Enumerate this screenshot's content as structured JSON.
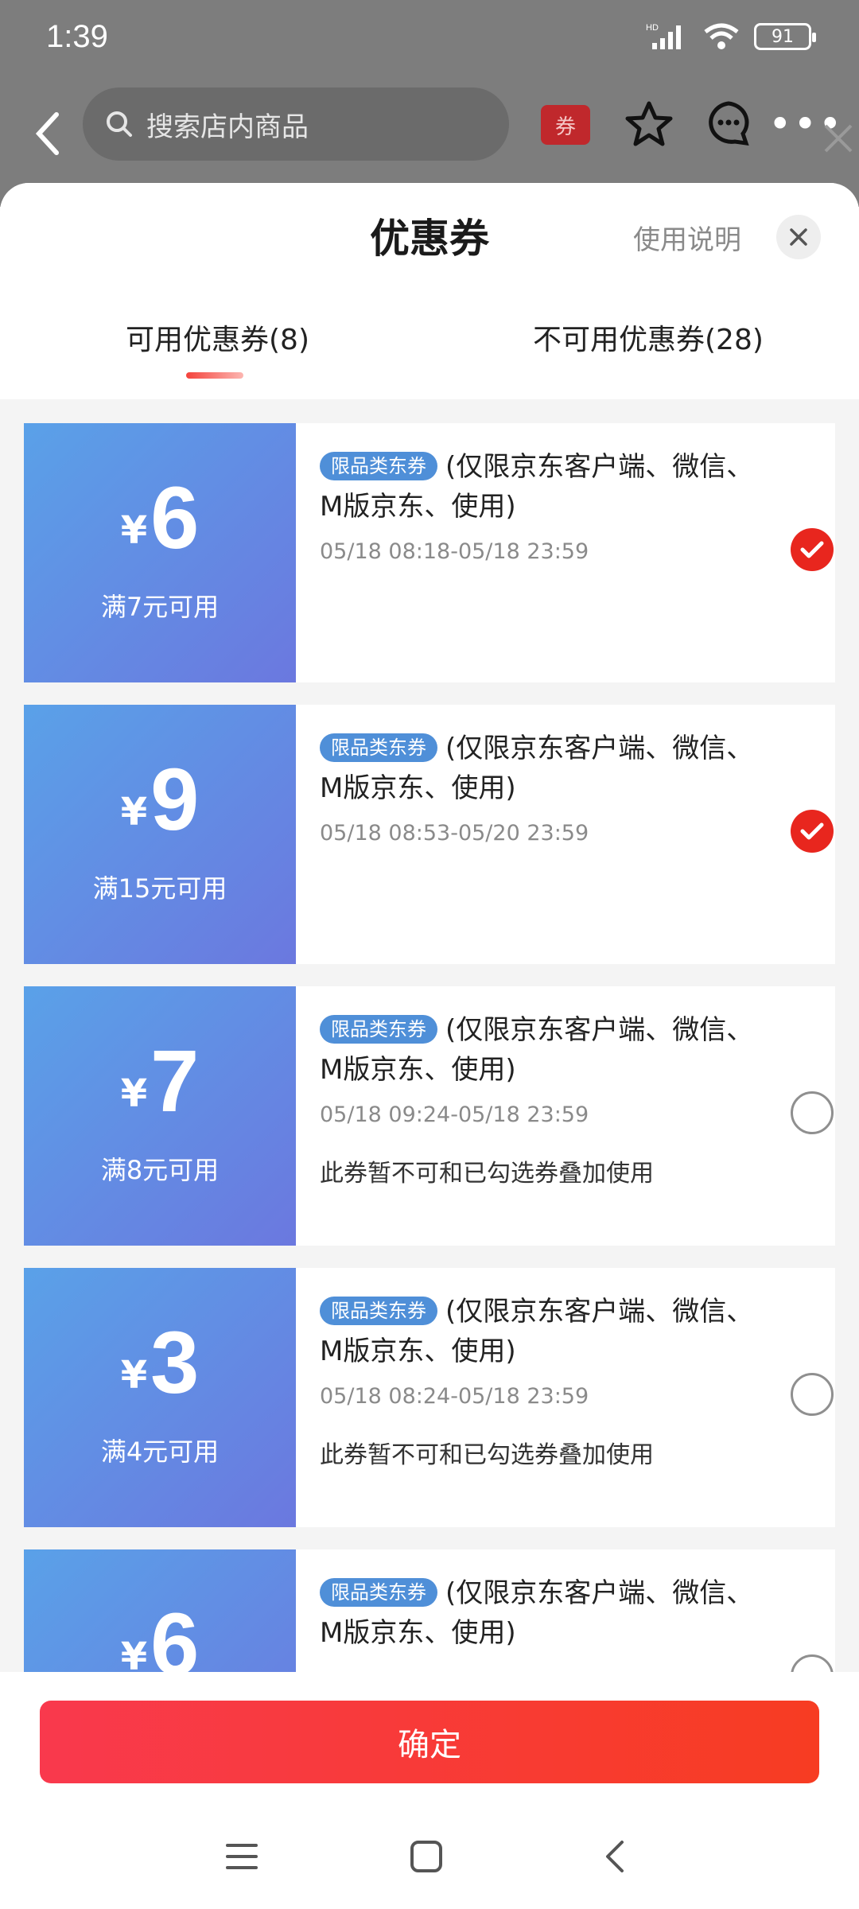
{
  "status_bar": {
    "time": "1:39",
    "battery": "91",
    "network": "HD"
  },
  "header": {
    "search_placeholder": "搜索店内商品",
    "coupon_icon_label": "券"
  },
  "sheet": {
    "title": "优惠券",
    "help_label": "使用说明",
    "tabs": [
      {
        "label": "可用优惠券(8)"
      },
      {
        "label": "不可用优惠券(28)"
      }
    ]
  },
  "coupons": [
    {
      "yen": "¥",
      "amount": "6",
      "condition": "满7元可用",
      "tag": "限品类东券",
      "desc": "(仅限京东客户端、微信、M版京东、使用)",
      "date": "05/18 08:18-05/18 23:59",
      "note": "",
      "selected": true
    },
    {
      "yen": "¥",
      "amount": "9",
      "condition": "满15元可用",
      "tag": "限品类东券",
      "desc": "(仅限京东客户端、微信、M版京东、使用)",
      "date": "05/18 08:53-05/20 23:59",
      "note": "",
      "selected": true
    },
    {
      "yen": "¥",
      "amount": "7",
      "condition": "满8元可用",
      "tag": "限品类东券",
      "desc": "(仅限京东客户端、微信、M版京东、使用)",
      "date": "05/18 09:24-05/18 23:59",
      "note": "此券暂不可和已勾选券叠加使用",
      "selected": false
    },
    {
      "yen": "¥",
      "amount": "3",
      "condition": "满4元可用",
      "tag": "限品类东券",
      "desc": "(仅限京东客户端、微信、M版京东、使用)",
      "date": "05/18 08:24-05/18 23:59",
      "note": "此券暂不可和已勾选券叠加使用",
      "selected": false
    },
    {
      "yen": "¥",
      "amount": "6",
      "condition": "",
      "tag": "限品类东券",
      "desc": "(仅限京东客户端、微信、M版京东、使用)",
      "date": "",
      "note": "",
      "selected": false
    }
  ],
  "footer": {
    "confirm_label": "确定"
  }
}
